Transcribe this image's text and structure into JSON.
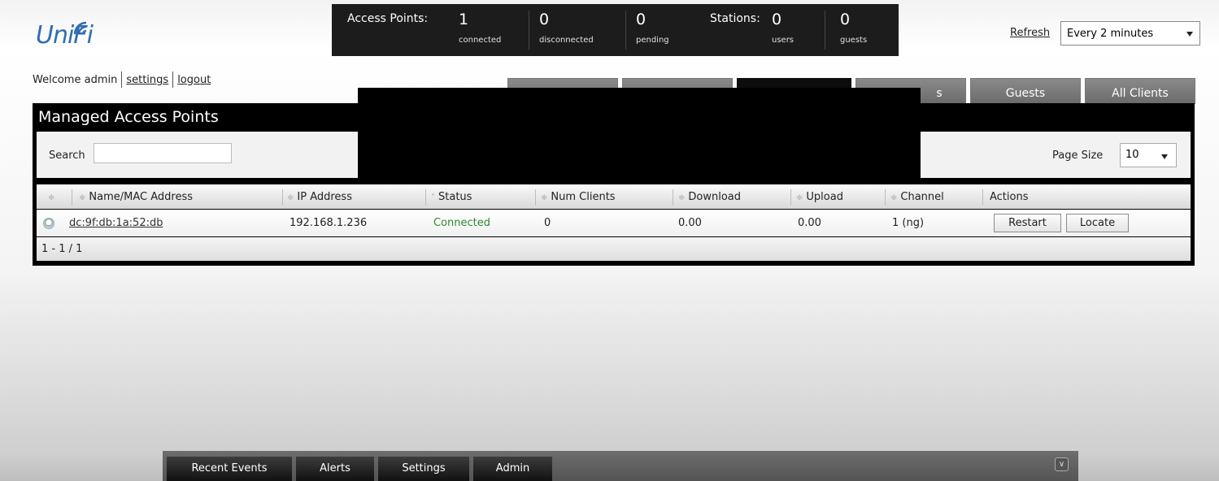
{
  "logo": {
    "text": "UniFi"
  },
  "welcome": {
    "text": "Welcome admin",
    "settings": "settings",
    "logout": "logout"
  },
  "statusbar": {
    "access_points_label": "Access Points:",
    "ap": [
      {
        "value": "1",
        "label": "connected"
      },
      {
        "value": "0",
        "label": "disconnected"
      },
      {
        "value": "0",
        "label": "pending"
      }
    ],
    "stations_label": "Stations:",
    "stations": [
      {
        "value": "0",
        "label": "users"
      },
      {
        "value": "0",
        "label": "guests"
      }
    ]
  },
  "refresh": {
    "link": "Refresh",
    "selected": "Every 2 minutes"
  },
  "tabs": [
    {
      "label": "s"
    },
    {
      "label": "Guests"
    },
    {
      "label": "All Clients"
    }
  ],
  "panel": {
    "title": "Managed Access Points",
    "search_label": "Search",
    "search_value": "",
    "page_size_label": "Page Size",
    "page_size_value": "10",
    "columns": [
      "Name/MAC Address",
      "IP Address",
      "Status",
      "Num Clients",
      "Download",
      "Upload",
      "Channel",
      "Actions"
    ],
    "rows": [
      {
        "name": "dc:9f:db:1a:52:db",
        "ip": "192.168.1.236",
        "status": "Connected",
        "num_clients": "0",
        "download": "0.00",
        "upload": "0.00",
        "channel": "1 (ng)",
        "actions": [
          "Restart",
          "Locate"
        ]
      }
    ],
    "pager": "1 - 1 / 1"
  },
  "bottombar": {
    "tabs": [
      "Recent Events",
      "Alerts",
      "Settings",
      "Admin"
    ]
  },
  "colors": {
    "status_connected": "#2f8a2f",
    "logo": "#2f6db3"
  },
  "icons": [
    "wifi-arcs-icon",
    "sort-icon",
    "access-point-icon",
    "chevron-down-icon",
    "collapse-icon"
  ]
}
